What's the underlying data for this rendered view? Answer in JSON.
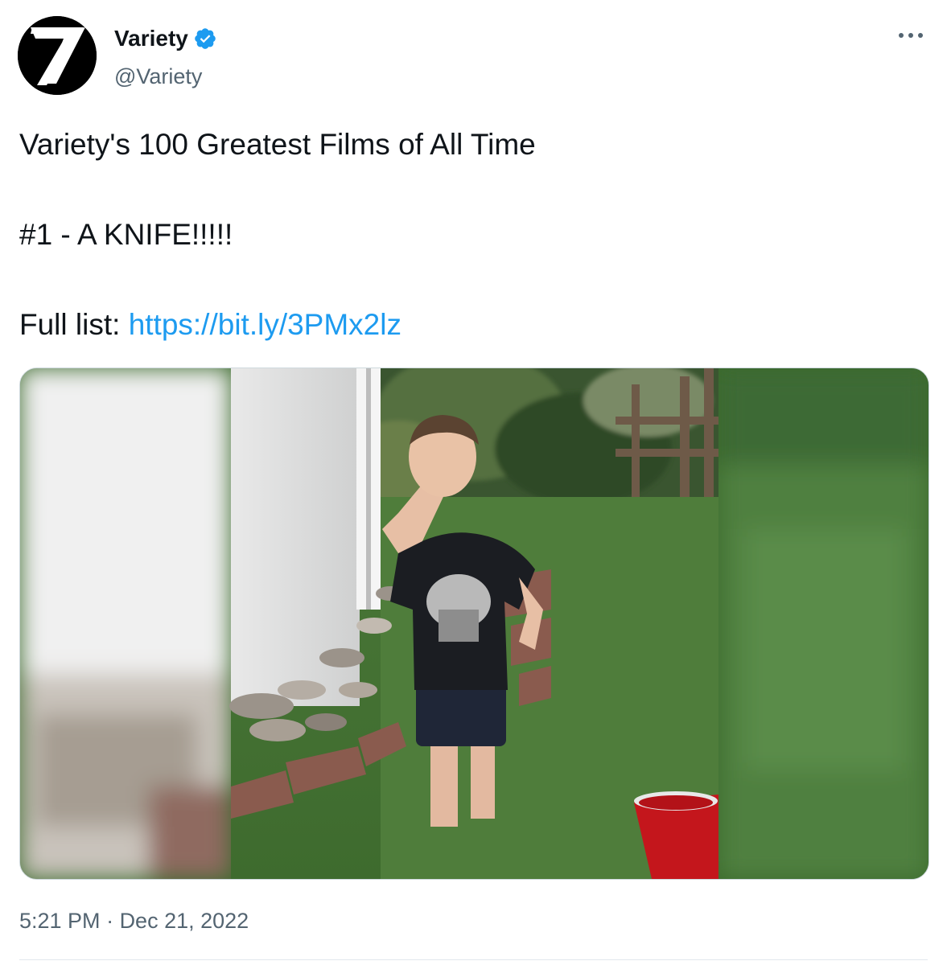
{
  "author": {
    "display_name": "Variety",
    "handle": "@Variety",
    "verified": true,
    "avatar_icon": "variety-v-logo-icon"
  },
  "tweet": {
    "lines": [
      "Variety's 100 Greatest Films of All Time",
      "#1 - A KNIFE!!!!!",
      "Full list: "
    ],
    "link_text": "https://bit.ly/3PMx2lz"
  },
  "media": {
    "type": "video-still"
  },
  "timestamp": {
    "time": "5:21 PM",
    "separator": " · ",
    "date": "Dec 21, 2022"
  },
  "colors": {
    "link": "#1d9bf0",
    "verified": "#1d9bf0",
    "secondary_text": "#536471",
    "primary_text": "#0f1419"
  }
}
